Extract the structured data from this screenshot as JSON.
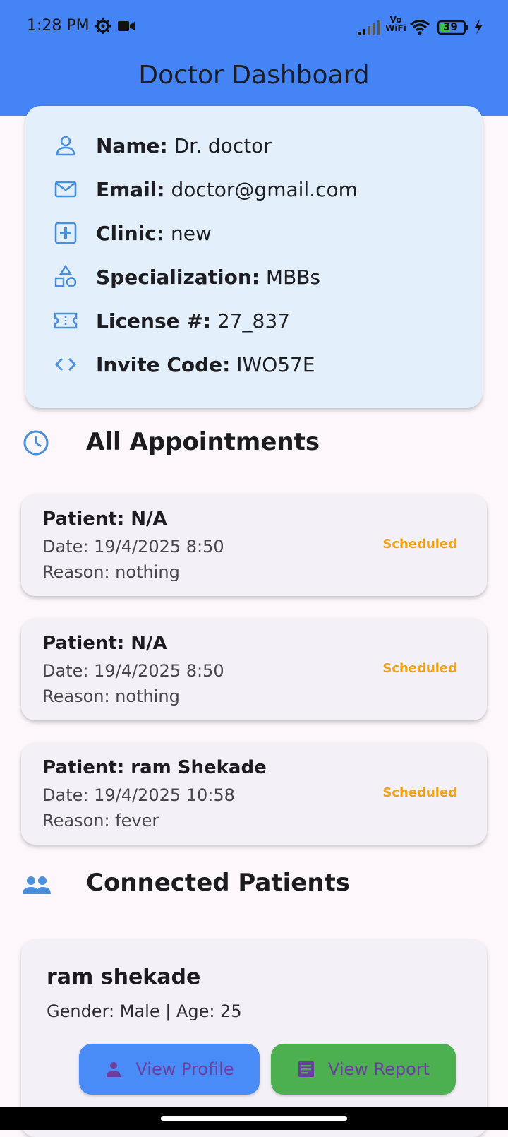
{
  "status_bar": {
    "time": "1:28 PM",
    "vowifi_line1": "Vo",
    "vowifi_line2": "WiFi",
    "battery": "39",
    "icons": [
      "gear-icon",
      "video-camera-icon",
      "signal-icon",
      "wifi-icon",
      "battery-icon",
      "charging-bolt-icon"
    ]
  },
  "app_bar": {
    "title": "Doctor Dashboard",
    "color": "#4584f5"
  },
  "profile": {
    "rows": [
      {
        "icon": "person-icon",
        "label": "Name:",
        "value": " Dr. doctor"
      },
      {
        "icon": "mail-icon",
        "label": "Email:",
        "value": " doctor@gmail.com"
      },
      {
        "icon": "medical-plus-icon",
        "label": "Clinic:",
        "value": " new"
      },
      {
        "icon": "category-shapes-icon",
        "label": "Specialization:",
        "value": " MBBs"
      },
      {
        "icon": "badge-ticket-icon",
        "label": "License #:",
        "value": " 27_837"
      },
      {
        "icon": "code-icon",
        "label": "Invite Code:",
        "value": " IWO57E"
      }
    ],
    "card_color": "#e3f0fb",
    "icon_color": "#4a8fdc"
  },
  "appointments_section": {
    "title": "All Appointments",
    "icon": "clock-icon"
  },
  "appointments": [
    {
      "patient": "Patient: N/A",
      "date": "Date: 19/4/2025 8:50",
      "reason": "Reason: nothing",
      "status": "Scheduled"
    },
    {
      "patient": "Patient: N/A",
      "date": "Date: 19/4/2025 8:50",
      "reason": "Reason: nothing",
      "status": "Scheduled"
    },
    {
      "patient": "Patient: ram Shekade",
      "date": "Date: 19/4/2025 10:58",
      "reason": "Reason: fever",
      "status": "Scheduled"
    }
  ],
  "patients_section": {
    "title": "Connected Patients",
    "icon": "group-icon"
  },
  "patients": [
    {
      "name": "ram shekade",
      "info": "Gender: Male | Age: 25",
      "view_profile": "View Profile",
      "view_report": "View Report"
    }
  ],
  "colors": {
    "status_scheduled": "#f0a21b",
    "btn_profile": "#4a8cf7",
    "btn_report": "#4caf50"
  }
}
